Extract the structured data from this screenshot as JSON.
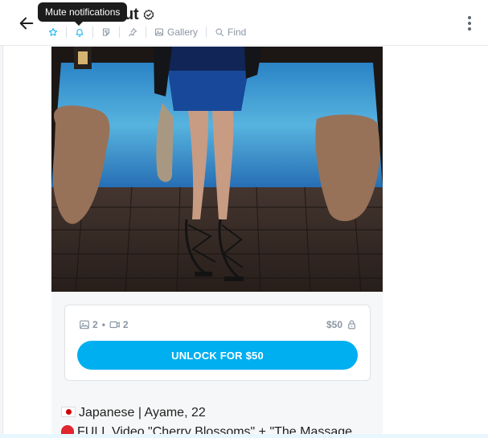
{
  "header": {
    "title": "naut",
    "tooltip": "Mute notifications",
    "toolbar": {
      "gallery_label": "Gallery",
      "find_label": "Find"
    }
  },
  "post": {
    "locked": {
      "images_count": "2",
      "videos_count": "2",
      "dot": "•",
      "price": "$50",
      "unlock_label": "UNLOCK FOR $50"
    },
    "description": {
      "line1": "Japanese | Ayame, 22",
      "line2": "FULL Video \"Cherry Blossoms\" + \"The Massage"
    }
  },
  "colors": {
    "accent": "#00aff0",
    "muted": "#8a96a3",
    "active_icon": "#00aff0"
  },
  "icons": [
    "back-arrow-icon",
    "verified-icon",
    "star-icon",
    "bell-icon",
    "note-icon",
    "pin-icon",
    "image-icon",
    "search-icon",
    "more-vertical-icon",
    "video-icon",
    "lock-icon",
    "japan-flag-icon",
    "siren-icon"
  ]
}
